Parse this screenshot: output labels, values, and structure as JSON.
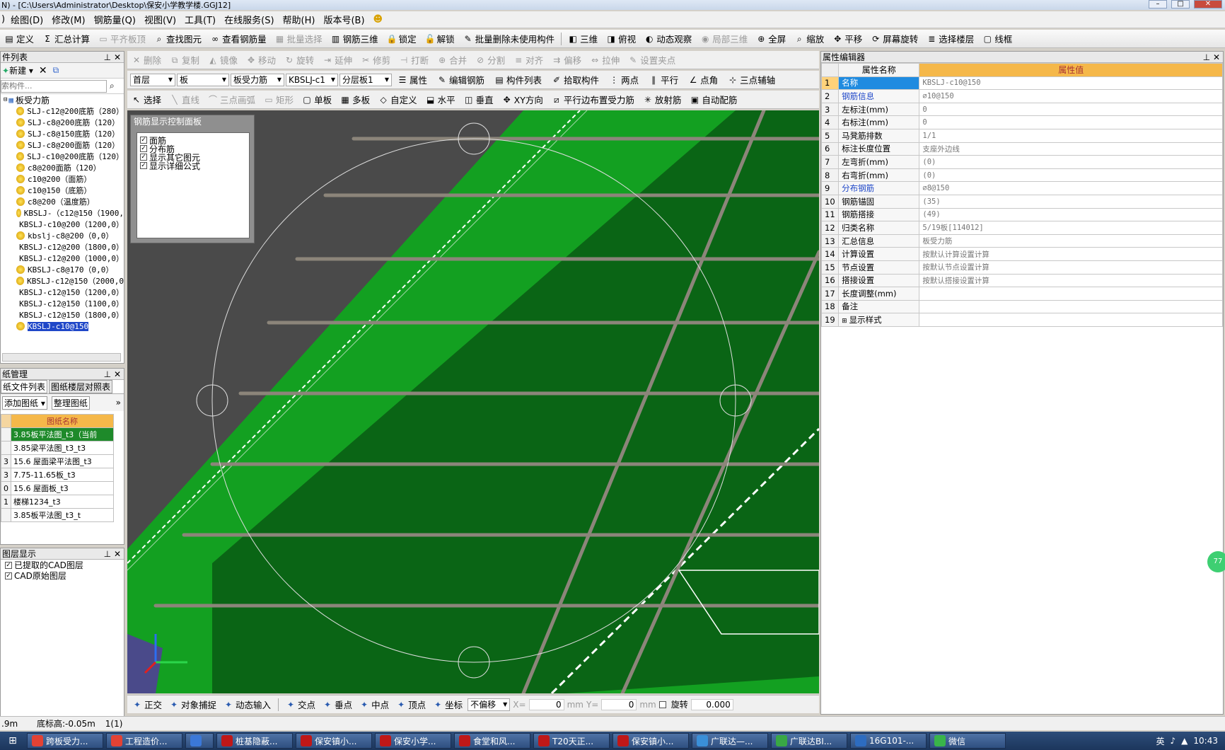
{
  "title_bar": {
    "text": "N) - [C:\\Users\\Administrator\\Desktop\\保安小学教学楼.GGJ12]"
  },
  "menu": [
    "绘图(D)",
    "修改(M)",
    "钢筋量(Q)",
    "视图(V)",
    "工具(T)",
    "在线服务(S)",
    "帮助(H)",
    "版本号(B)"
  ],
  "menu_first": ")",
  "toolbar1": {
    "left": [
      {
        "icon": "define-icon",
        "label": "定义",
        "disabled": false
      },
      {
        "icon": "sum-icon",
        "label": "汇总计算",
        "disabled": false
      },
      {
        "icon": "flush-icon",
        "label": "平齐板顶",
        "disabled": true
      },
      {
        "icon": "find-icon",
        "label": "查找图元",
        "disabled": false
      },
      {
        "icon": "rebar-qty-icon",
        "label": "查看钢筋量",
        "disabled": false
      },
      {
        "icon": "batch-select-icon",
        "label": "批量选择",
        "disabled": true
      },
      {
        "icon": "rebar3d-icon",
        "label": "钢筋三维",
        "disabled": false
      },
      {
        "icon": "lock-icon",
        "label": "锁定",
        "disabled": false
      },
      {
        "icon": "unlock-icon",
        "label": "解锁",
        "disabled": false
      },
      {
        "icon": "batch-delete-icon",
        "label": "批量删除未使用构件",
        "disabled": false
      }
    ],
    "right": [
      {
        "icon": "3d-icon",
        "label": "三维",
        "disabled": false
      },
      {
        "icon": "topview-icon",
        "label": "俯视",
        "disabled": false
      },
      {
        "icon": "dynamic-view-icon",
        "label": "动态观察",
        "disabled": false
      },
      {
        "icon": "partial3d-icon",
        "label": "局部三维",
        "disabled": true
      },
      {
        "icon": "fullscreen-icon",
        "label": "全屏",
        "disabled": false
      },
      {
        "icon": "zoom-icon",
        "label": "缩放",
        "disabled": false
      },
      {
        "icon": "pan-icon",
        "label": "平移",
        "disabled": false
      },
      {
        "icon": "rotate-screen-icon",
        "label": "屏幕旋转",
        "disabled": false
      },
      {
        "icon": "select-floor-icon",
        "label": "选择楼层",
        "disabled": false
      },
      {
        "icon": "wireframe-icon",
        "label": "线框",
        "disabled": false
      }
    ]
  },
  "toolbar2": [
    {
      "icon": "delete-icon",
      "label": "删除",
      "disabled": true
    },
    {
      "icon": "copy-icon",
      "label": "复制",
      "disabled": true
    },
    {
      "icon": "mirror-icon",
      "label": "镜像",
      "disabled": true
    },
    {
      "icon": "move-icon",
      "label": "移动",
      "disabled": true
    },
    {
      "icon": "rotate-icon",
      "label": "旋转",
      "disabled": true
    },
    {
      "icon": "extend-icon",
      "label": "延伸",
      "disabled": true
    },
    {
      "icon": "trim-icon",
      "label": "修剪",
      "disabled": true
    },
    {
      "icon": "break-icon",
      "label": "打断",
      "disabled": true
    },
    {
      "icon": "merge-icon",
      "label": "合并",
      "disabled": true
    },
    {
      "icon": "split-icon",
      "label": "分割",
      "disabled": true
    },
    {
      "icon": "align-icon",
      "label": "对齐",
      "disabled": true
    },
    {
      "icon": "offset-icon",
      "label": "偏移",
      "disabled": true
    },
    {
      "icon": "stretch-icon",
      "label": "拉伸",
      "disabled": true
    },
    {
      "icon": "grip-icon",
      "label": "设置夹点",
      "disabled": true
    }
  ],
  "toolbar3": {
    "selects": [
      "首层",
      "板",
      "板受力筋",
      "KBSLJ-c1",
      "分层板1"
    ],
    "buttons": [
      {
        "icon": "property-icon",
        "label": "属性"
      },
      {
        "icon": "edit-rebar-icon",
        "label": "编辑钢筋"
      },
      {
        "icon": "component-list-icon",
        "label": "构件列表"
      },
      {
        "icon": "pick-icon",
        "label": "拾取构件"
      },
      {
        "icon": "two-point-icon",
        "label": "两点"
      },
      {
        "icon": "parallel-icon",
        "label": "平行"
      },
      {
        "icon": "point-angle-icon",
        "label": "点角"
      },
      {
        "icon": "three-point-axis-icon",
        "label": "三点辅轴"
      }
    ]
  },
  "toolbar4": [
    {
      "icon": "select-icon",
      "label": "选择",
      "disabled": false
    },
    {
      "icon": "line-icon",
      "label": "直线",
      "disabled": true
    },
    {
      "icon": "arc-icon",
      "label": "三点画弧",
      "disabled": true
    },
    {
      "icon": "rect-icon",
      "label": "矩形",
      "disabled": true
    },
    {
      "icon": "single-board-icon",
      "label": "单板",
      "disabled": false
    },
    {
      "icon": "multi-board-icon",
      "label": "多板",
      "disabled": false
    },
    {
      "icon": "custom-icon",
      "label": "自定义",
      "disabled": false
    },
    {
      "icon": "horizontal-icon",
      "label": "水平",
      "disabled": false
    },
    {
      "icon": "vertical-icon",
      "label": "垂直",
      "disabled": false
    },
    {
      "icon": "xy-icon",
      "label": "XY方向",
      "disabled": false
    },
    {
      "icon": "parallel-edge-icon",
      "label": "平行边布置受力筋",
      "disabled": false
    },
    {
      "icon": "radial-icon",
      "label": "放射筋",
      "disabled": false
    },
    {
      "icon": "auto-rebar-icon",
      "label": "自动配筋",
      "disabled": false
    }
  ],
  "component_list": {
    "header": "件列表",
    "new_label": "新建",
    "search_placeholder": "索构件...",
    "root": "板受力筋",
    "items": [
      "SLJ-c12@200底筋（280）",
      "SLJ-c8@200底筋（120）",
      "SLJ-c8@150底筋（120）",
      "SLJ-c8@200面筋（120）",
      "SLJ-c10@200底筋（120）",
      "c8@200面筋（120）",
      "c10@200（面筋）",
      "c10@150（底筋）",
      "c8@200（温度筋）",
      "KBSLJ-（c12@150（1900,",
      "KBSLJ-c10@200（1200,0）",
      "kbslj-c8@200（0,0）",
      "KBSLJ-c12@200（1800,0）",
      "KBSLJ-c12@200（1000,0）",
      "KBSLJ-c8@170（0,0）",
      "KBSLJ-c12@150（2000,0",
      "KBSLJ-c12@150（1200,0）",
      "KBSLJ-c12@150（1100,0）",
      "KBSLJ-c12@150（1800,0）",
      "KBSLJ-c10@150"
    ],
    "selected_index": 19
  },
  "drawing_manager": {
    "header": "纸管理",
    "tabs": [
      "纸文件列表",
      "图纸楼层对照表"
    ],
    "add_label": "添加图纸",
    "organize_label": "整理图纸",
    "column": "图纸名称",
    "rows": [
      {
        "n": "",
        "name": "3.85板平法图_t3（当前"
      },
      {
        "n": "",
        "name": "3.85梁平法图_t3_t3"
      },
      {
        "n": "3",
        "name": "15.6 屋面梁平法图_t3"
      },
      {
        "n": "3",
        "name": "7.75-11.65板_t3"
      },
      {
        "n": "0",
        "name": "15.6 屋面板_t3"
      },
      {
        "n": "1",
        "name": "楼梯1234_t3"
      },
      {
        "n": "",
        "name": "3.85板平法图_t3_t"
      }
    ]
  },
  "layer_panel": {
    "header": "图层显示",
    "items": [
      "已提取的CAD图层",
      "CAD原始图层"
    ]
  },
  "rebar_display_panel": {
    "title": "钢筋显示控制面板",
    "items": [
      "面筋",
      "分布筋",
      "显示其它图元",
      "显示详细公式"
    ]
  },
  "property_editor": {
    "header": "属性编辑器",
    "col_name": "属性名称",
    "col_value": "属性值",
    "rows": [
      {
        "n": "1",
        "name": "名称",
        "value": "KBSLJ-c10@150"
      },
      {
        "n": "2",
        "name": "钢筋信息",
        "value": "⌀10@150"
      },
      {
        "n": "3",
        "name": "左标注(mm)",
        "value": "0"
      },
      {
        "n": "4",
        "name": "右标注(mm)",
        "value": "0"
      },
      {
        "n": "5",
        "name": "马凳筋排数",
        "value": "1/1"
      },
      {
        "n": "6",
        "name": "标注长度位置",
        "value": "支座外边线"
      },
      {
        "n": "7",
        "name": "左弯折(mm)",
        "value": "(0)"
      },
      {
        "n": "8",
        "name": "右弯折(mm)",
        "value": "(0)"
      },
      {
        "n": "9",
        "name": "分布钢筋",
        "value": "⌀8@150"
      },
      {
        "n": "10",
        "name": "钢筋锚固",
        "value": "(35)"
      },
      {
        "n": "11",
        "name": "钢筋搭接",
        "value": "(49)"
      },
      {
        "n": "12",
        "name": "归类名称",
        "value": "5/19板[114012]"
      },
      {
        "n": "13",
        "name": "汇总信息",
        "value": "板受力筋"
      },
      {
        "n": "14",
        "name": "计算设置",
        "value": "按默认计算设置计算"
      },
      {
        "n": "15",
        "name": "节点设置",
        "value": "按默认节点设置计算"
      },
      {
        "n": "16",
        "name": "搭接设置",
        "value": "按默认搭接设置计算"
      },
      {
        "n": "17",
        "name": "长度调整(mm)",
        "value": ""
      },
      {
        "n": "18",
        "name": "备注",
        "value": ""
      },
      {
        "n": "19",
        "name": "显示样式",
        "value": ""
      }
    ]
  },
  "snap_bar": {
    "items": [
      "正交",
      "对象捕捉",
      "动态输入",
      "交点",
      "垂点",
      "中点",
      "顶点",
      "坐标"
    ],
    "offset_mode": "不偏移",
    "x_label": "X=",
    "x_value": "0",
    "mm1": "mm",
    "y_label": "Y=",
    "y_value": "0",
    "mm2": "mm",
    "rotate_label": "旋转",
    "rotate_value": "0.000"
  },
  "status_bar": {
    "left": ".9m",
    "elevation": "底标高:-0.05m",
    "count": "1(1)"
  },
  "taskbar": {
    "items": [
      {
        "label": "跨板受力...",
        "color": "#e34234"
      },
      {
        "label": "工程造价...",
        "color": "#e34234"
      },
      {
        "label": "",
        "color": "#3b78d8"
      },
      {
        "label": "桩基隐蔽...",
        "color": "#c01818"
      },
      {
        "label": "保安镇小...",
        "color": "#c01818"
      },
      {
        "label": "保安小学...",
        "color": "#c01818"
      },
      {
        "label": "食堂和风...",
        "color": "#c01818"
      },
      {
        "label": "T20天正...",
        "color": "#c01818"
      },
      {
        "label": "保安镇小...",
        "color": "#c01818"
      },
      {
        "label": "广联达—...",
        "color": "#3a8fd8"
      },
      {
        "label": "广联达BI...",
        "color": "#39a845"
      },
      {
        "label": "16G101-...",
        "color": "#2d6cc0"
      },
      {
        "label": "微信",
        "color": "#39b54a"
      }
    ],
    "tray": {
      "lang": "英",
      "time": "10:43"
    }
  },
  "colors": {
    "viewport_green": "#0f8a1e",
    "viewport_dark": "#0a5e14",
    "viewport_grey": "#4a4a4a",
    "selection_blue": "#1f47c8",
    "header_orange": "#f5b84a"
  }
}
